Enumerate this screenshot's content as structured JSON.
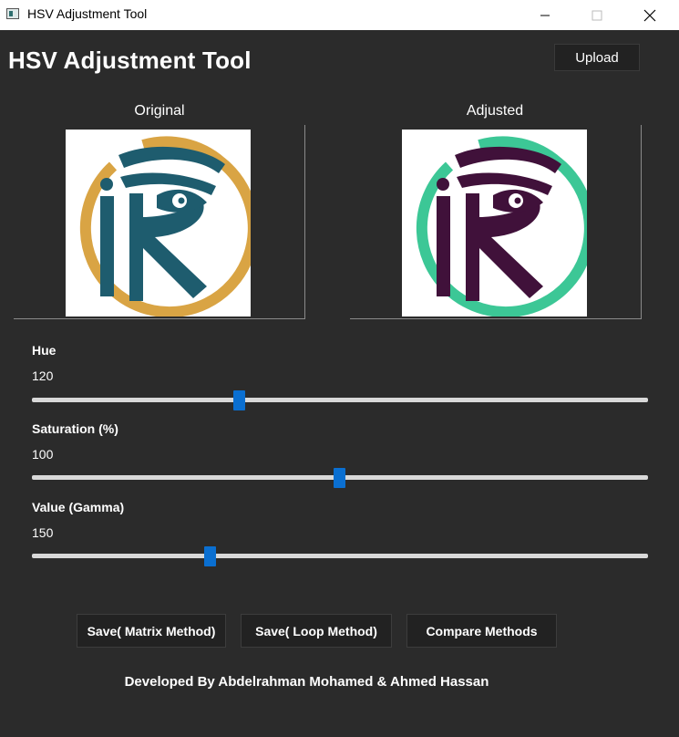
{
  "window": {
    "title": "HSV Adjustment Tool",
    "controls": [
      "minimize-icon",
      "maximize-icon",
      "close-icon"
    ]
  },
  "header": {
    "title": "HSV Adjustment Tool",
    "upload_label": "Upload"
  },
  "panels": {
    "original_label": "Original",
    "adjusted_label": "Adjusted",
    "original_colors": {
      "ring": "#d9a444",
      "letters": "#1e5c6e"
    },
    "adjusted_colors": {
      "ring": "#3cc796",
      "letters": "#40113a"
    }
  },
  "sliders": {
    "hue": {
      "label": "Hue",
      "value": "120",
      "level_fraction": 0.336
    },
    "saturation": {
      "label": "Saturation (%)",
      "value": "100",
      "level_fraction": 0.499
    },
    "value": {
      "label": "Value (Gamma)",
      "value": "150",
      "level_fraction": 0.289
    }
  },
  "actions": {
    "save_matrix": "Save( Matrix Method)",
    "save_loop": "Save( Loop Method)",
    "compare": "Compare Methods"
  },
  "footer": {
    "credit": "Developed By Abdelrahman Mohamed & Ahmed Hassan"
  },
  "colors": {
    "background": "#2b2b2b",
    "slider_thumb": "#0a6fd1",
    "slider_track": "#d9d9d9"
  }
}
